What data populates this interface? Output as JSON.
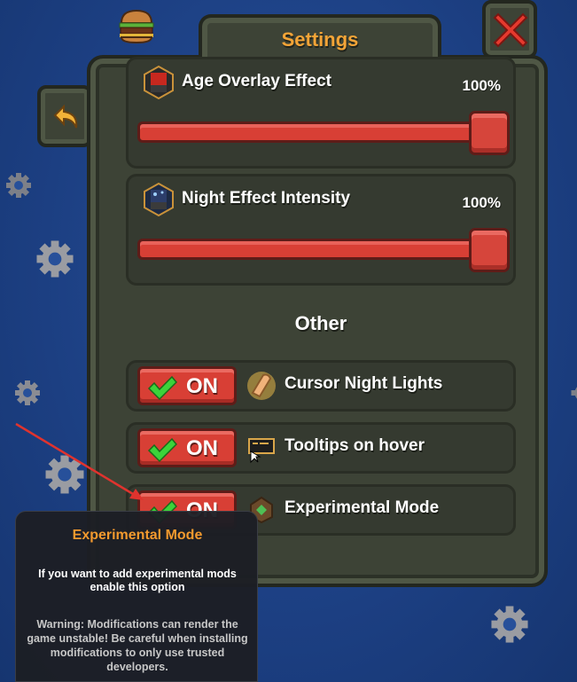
{
  "header": {
    "title": "Settings"
  },
  "sliders": [
    {
      "label": "Age Overlay Effect",
      "value_text": "100%",
      "level": 1.0,
      "icon": "age-overlay-icon"
    },
    {
      "label": "Night Effect Intensity",
      "value_text": "100%",
      "level": 1.0,
      "icon": "night-effect-icon"
    }
  ],
  "other": {
    "title": "Other",
    "toggles": [
      {
        "state": "ON",
        "label": "Cursor Night Lights",
        "icon": "cursor-light-icon"
      },
      {
        "state": "ON",
        "label": "Tooltips on hover",
        "icon": "tooltip-icon"
      },
      {
        "state": "ON",
        "label": "Experimental Mode",
        "icon": "experimental-icon"
      }
    ]
  },
  "tooltip": {
    "title": "Experimental Mode",
    "body": "If you want to add experimental mods enable this option",
    "warning": "Warning: Modifications can render the game unstable! Be careful when installing modifications to only use trusted developers."
  },
  "colors": {
    "accent": "#f3a437",
    "toggle_on": "#d83f35",
    "check": "#3cd33a",
    "close_x": "#e63a2e",
    "background": "#1f4388"
  }
}
